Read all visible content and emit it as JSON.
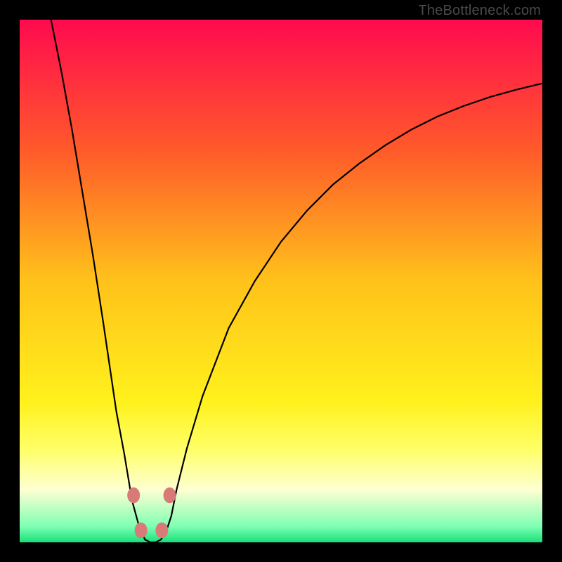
{
  "watermark": "TheBottleneck.com",
  "chart_data": {
    "type": "line",
    "title": "",
    "xlabel": "",
    "ylabel": "",
    "xlim": [
      0,
      100
    ],
    "ylim": [
      0,
      100
    ],
    "grid": false,
    "legend": false,
    "background_gradient": {
      "stops": [
        {
          "offset": 0.0,
          "color": "#ff0a4f"
        },
        {
          "offset": 0.25,
          "color": "#ff5a2a"
        },
        {
          "offset": 0.5,
          "color": "#ffc21a"
        },
        {
          "offset": 0.73,
          "color": "#fff11c"
        },
        {
          "offset": 0.82,
          "color": "#ffff66"
        },
        {
          "offset": 0.9,
          "color": "#fdffd2"
        },
        {
          "offset": 0.97,
          "color": "#7dffb2"
        },
        {
          "offset": 1.0,
          "color": "#17e07a"
        }
      ]
    },
    "series": [
      {
        "name": "curve",
        "stroke": "#000000",
        "x": [
          6.0,
          8.0,
          10.0,
          12.0,
          14.0,
          16.0,
          18.5,
          20.0,
          21.5,
          23.0,
          24.0,
          25.0,
          26.0,
          27.0,
          28.0,
          29.0,
          30.0,
          32.0,
          35.0,
          40.0,
          45.0,
          50.0,
          55.0,
          60.0,
          65.0,
          70.0,
          75.0,
          80.0,
          85.0,
          90.0,
          95.0,
          100.0
        ],
        "y": [
          100.0,
          90.0,
          79.0,
          67.0,
          55.0,
          42.0,
          25.0,
          17.0,
          8.0,
          2.5,
          0.5,
          0.0,
          0.0,
          0.5,
          2.0,
          5.0,
          10.0,
          18.0,
          28.0,
          41.0,
          50.0,
          57.5,
          63.5,
          68.5,
          72.5,
          76.0,
          79.0,
          81.5,
          83.5,
          85.2,
          86.6,
          87.8
        ]
      }
    ],
    "markers": [
      {
        "x": 21.8,
        "y": 9.0,
        "color": "#d87a78",
        "r": 9
      },
      {
        "x": 23.2,
        "y": 2.3,
        "color": "#d87a78",
        "r": 9
      },
      {
        "x": 27.2,
        "y": 2.3,
        "color": "#d87a78",
        "r": 9
      },
      {
        "x": 28.7,
        "y": 9.0,
        "color": "#d87a78",
        "r": 9
      }
    ]
  }
}
